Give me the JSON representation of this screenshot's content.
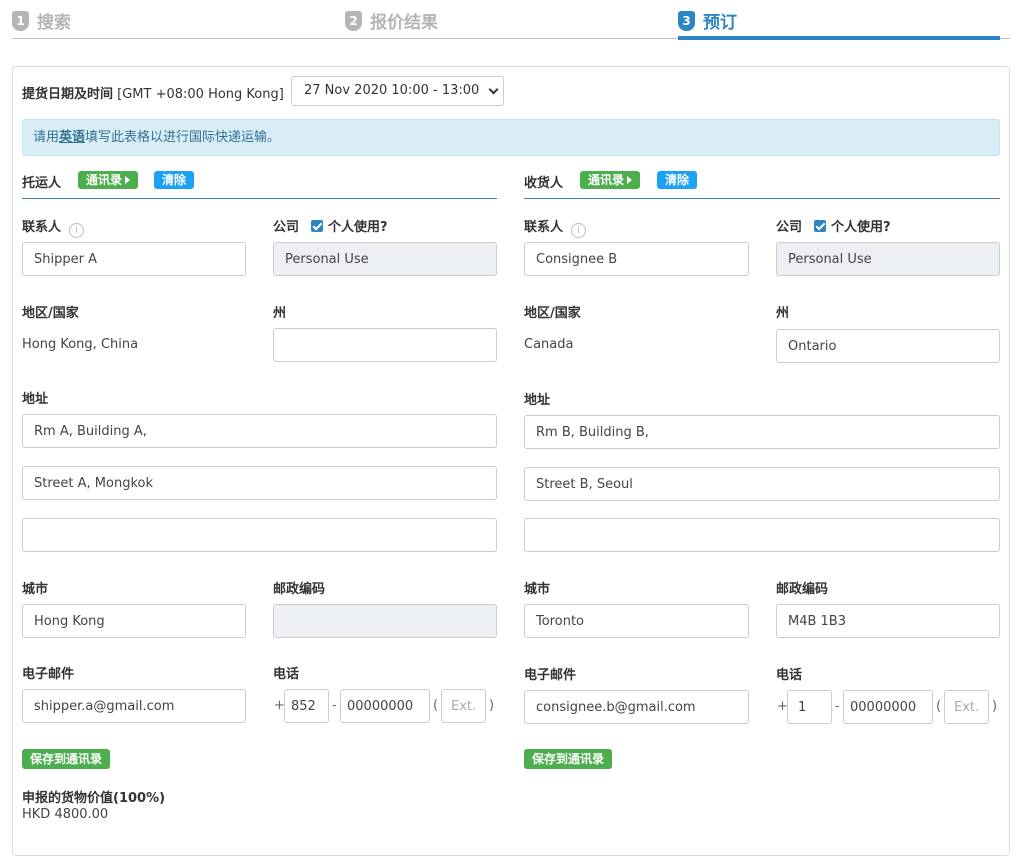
{
  "steps": [
    {
      "num": "1",
      "label": "搜索"
    },
    {
      "num": "2",
      "label": "报价结果"
    },
    {
      "num": "3",
      "label": "预订"
    }
  ],
  "pickup": {
    "label": "提货日期及时间",
    "timezone": "[GMT +08:00 Hong Kong]",
    "selected": "27 Nov 2020 10:00 - 13:00"
  },
  "alert": {
    "pre": "请用",
    "link": "英语",
    "post": "填写此表格以进行国际快递运输。"
  },
  "shipper": {
    "title": "托运人",
    "address_book": "通讯录",
    "clear": "清除",
    "contact_label": "联系人",
    "contact": "Shipper A",
    "company_label": "公司",
    "personal_label": "个人使用?",
    "company": "Personal Use",
    "country_label": "地区/国家",
    "country": "Hong Kong, China",
    "state_label": "州",
    "state": "",
    "address_label": "地址",
    "address1": "Rm A, Building A,",
    "address2": "Street A, Mongkok",
    "address3": "",
    "city_label": "城市",
    "city": "Hong Kong",
    "zip_label": "邮政编码",
    "zip": "",
    "email_label": "电子邮件",
    "email": "shipper.a@gmail.com",
    "phone_label": "电话",
    "phone_cc": "852",
    "phone_no": "00000000",
    "phone_ext_ph": "Ext.",
    "save": "保存到通讯录"
  },
  "consignee": {
    "title": "收货人",
    "address_book": "通讯录",
    "clear": "清除",
    "contact_label": "联系人",
    "contact": "Consignee B",
    "company_label": "公司",
    "personal_label": "个人使用?",
    "company": "Personal Use",
    "country_label": "地区/国家",
    "country": "Canada",
    "state_label": "州",
    "state": "Ontario",
    "address_label": "地址",
    "address1": "Rm B, Building B,",
    "address2": "Street B, Seoul",
    "address3": "",
    "city_label": "城市",
    "city": "Toronto",
    "zip_label": "邮政编码",
    "zip": "M4B 1B3",
    "email_label": "电子邮件",
    "email": "consignee.b@gmail.com",
    "phone_label": "电话",
    "phone_cc": "1",
    "phone_no": "00000000",
    "phone_ext_ph": "Ext.",
    "save": "保存到通讯录"
  },
  "phone_symbols": {
    "plus": "+",
    "dash": "-",
    "lparen": "(",
    "rparen": ")"
  },
  "declared": {
    "label": "申报的货物价值(100%)",
    "value": "HKD 4800.00"
  },
  "colors": {
    "accent": "#2d86c3",
    "green": "#4cae4c",
    "blue_tag": "#1da1f2",
    "alert_bg": "#d9edf7"
  }
}
